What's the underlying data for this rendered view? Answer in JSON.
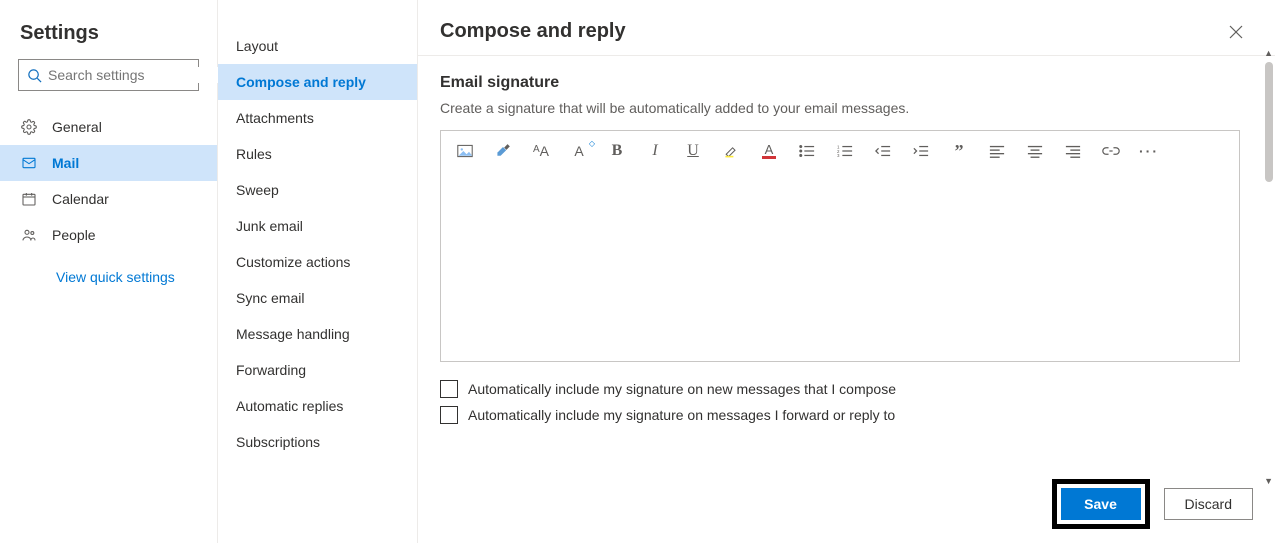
{
  "sidebar": {
    "title": "Settings",
    "search_placeholder": "Search settings",
    "items": [
      {
        "label": "General"
      },
      {
        "label": "Mail"
      },
      {
        "label": "Calendar"
      },
      {
        "label": "People"
      }
    ],
    "quick_link": "View quick settings"
  },
  "subnav": {
    "items": [
      "Layout",
      "Compose and reply",
      "Attachments",
      "Rules",
      "Sweep",
      "Junk email",
      "Customize actions",
      "Sync email",
      "Message handling",
      "Forwarding",
      "Automatic replies",
      "Subscriptions"
    ]
  },
  "main": {
    "title": "Compose and reply",
    "section_title": "Email signature",
    "section_desc": "Create a signature that will be automatically added to your email messages.",
    "checkbox1": "Automatically include my signature on new messages that I compose",
    "checkbox2": "Automatically include my signature on messages I forward or reply to"
  },
  "footer": {
    "save": "Save",
    "discard": "Discard"
  },
  "toolbar_icons": [
    "image",
    "paint",
    "font-family",
    "font-size",
    "bold",
    "italic",
    "underline",
    "highlight",
    "font-color",
    "bullets",
    "numbering",
    "outdent",
    "indent",
    "quote",
    "align-left",
    "align-center",
    "align-right",
    "link",
    "more"
  ]
}
